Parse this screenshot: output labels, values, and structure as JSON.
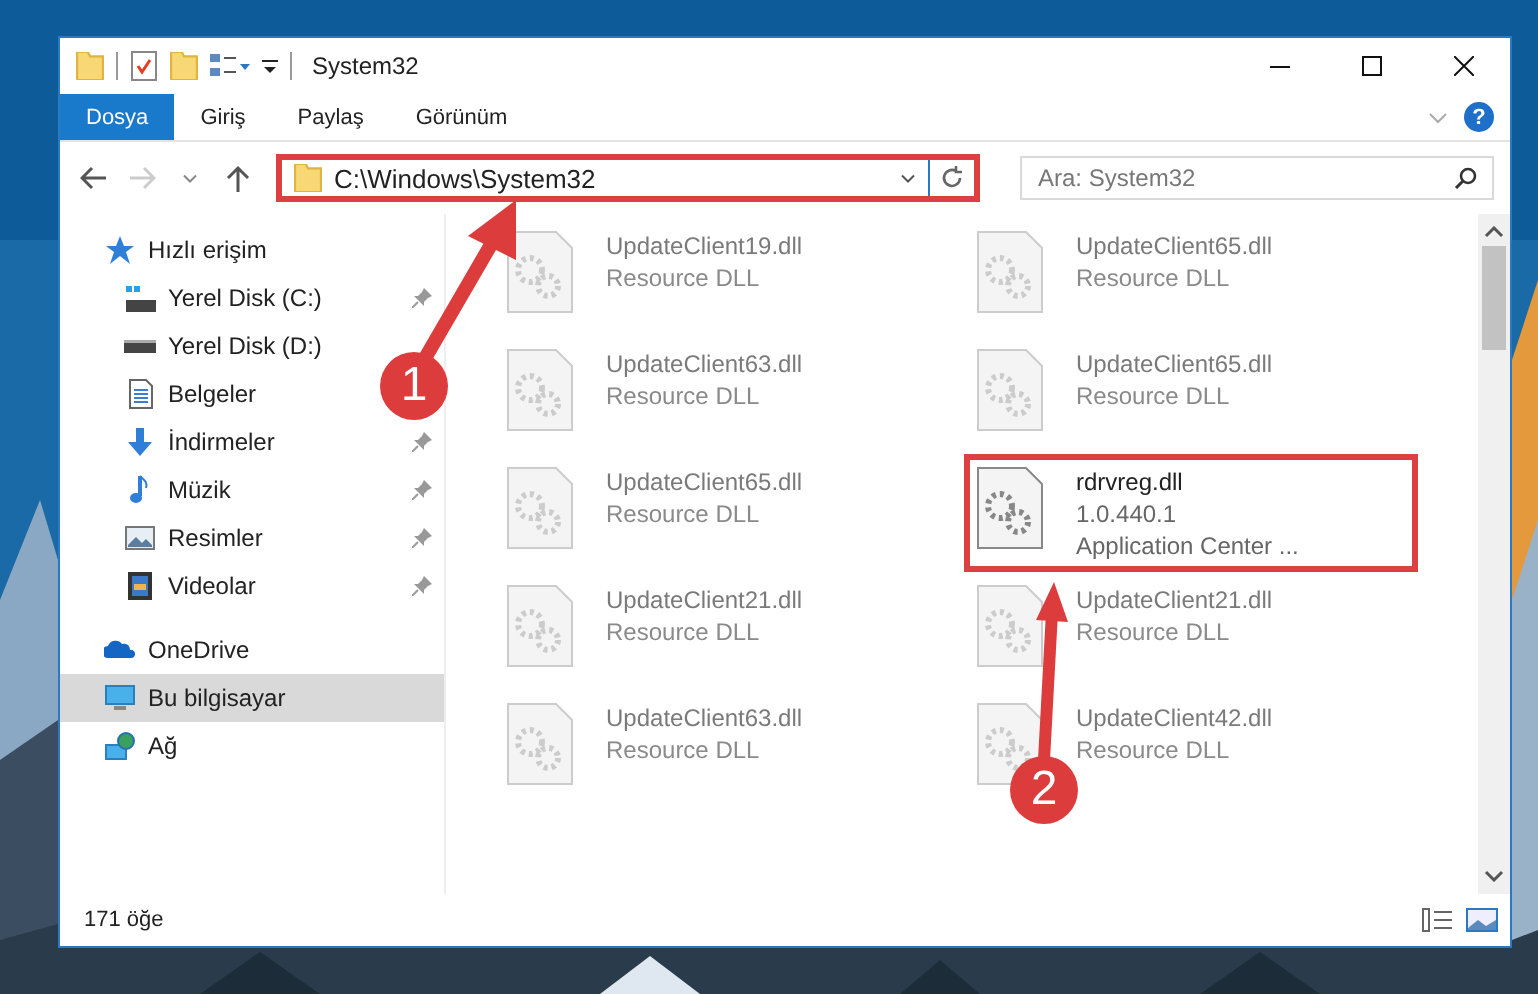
{
  "window": {
    "title": "System32"
  },
  "ribbon_tabs": [
    {
      "label": "Dosya",
      "selected": true
    },
    {
      "label": "Giriş",
      "selected": false
    },
    {
      "label": "Paylaş",
      "selected": false
    },
    {
      "label": "Görünüm",
      "selected": false
    }
  ],
  "help_button": "?",
  "address_bar": {
    "value": "C:\\Windows\\System32",
    "highlighted": true
  },
  "search": {
    "placeholder": "Ara: System32"
  },
  "sidebar": {
    "items": [
      {
        "label": "Hızlı erişim",
        "kind": "star",
        "selected": false,
        "children": [
          {
            "label": "Yerel Disk (C:)",
            "kind": "windrive",
            "pinned": true,
            "selected": false
          },
          {
            "label": "Yerel Disk (D:)",
            "kind": "drive",
            "pinned": false,
            "selected": false
          },
          {
            "label": "Belgeler",
            "kind": "docs",
            "pinned": false,
            "selected": false
          },
          {
            "label": "İndirmeler",
            "kind": "download",
            "pinned": true,
            "selected": false
          },
          {
            "label": "Müzik",
            "kind": "music",
            "pinned": true,
            "selected": false
          },
          {
            "label": "Resimler",
            "kind": "pictures",
            "pinned": true,
            "selected": false
          },
          {
            "label": "Videolar",
            "kind": "videos",
            "pinned": true,
            "selected": false
          }
        ]
      },
      {
        "label": "OneDrive",
        "kind": "cloud",
        "selected": false
      },
      {
        "label": "Bu bilgisayar",
        "kind": "computer",
        "selected": true
      },
      {
        "label": "Ağ",
        "kind": "network",
        "selected": false
      }
    ]
  },
  "files": [
    {
      "name": "UpdateClient19.dll",
      "lines": [
        "Resource DLL"
      ],
      "blurred": true,
      "highlighted": false
    },
    {
      "name": "UpdateClient65.dll",
      "lines": [
        "Resource DLL"
      ],
      "blurred": true,
      "highlighted": false
    },
    {
      "name": "UpdateClient63.dll",
      "lines": [
        "Resource DLL"
      ],
      "blurred": true,
      "highlighted": false
    },
    {
      "name": "UpdateClient65.dll",
      "lines": [
        "Resource DLL"
      ],
      "blurred": true,
      "highlighted": false
    },
    {
      "name": "UpdateClient65.dll",
      "lines": [
        "Resource DLL"
      ],
      "blurred": true,
      "highlighted": false
    },
    {
      "name": "rdrvreg.dll",
      "lines": [
        "1.0.440.1",
        "Application Center ..."
      ],
      "blurred": false,
      "highlighted": true
    },
    {
      "name": "UpdateClient21.dll",
      "lines": [
        "Resource DLL"
      ],
      "blurred": true,
      "highlighted": false
    },
    {
      "name": "UpdateClient21.dll",
      "lines": [
        "Resource DLL"
      ],
      "blurred": true,
      "highlighted": false
    },
    {
      "name": "UpdateClient63.dll",
      "lines": [
        "Resource DLL"
      ],
      "blurred": true,
      "highlighted": false
    },
    {
      "name": "UpdateClient42.dll",
      "lines": [
        "Resource DLL"
      ],
      "blurred": true,
      "highlighted": false
    }
  ],
  "status_bar": {
    "item_count": "171 öğe"
  },
  "annotations": [
    {
      "number": "1"
    },
    {
      "number": "2"
    }
  ]
}
